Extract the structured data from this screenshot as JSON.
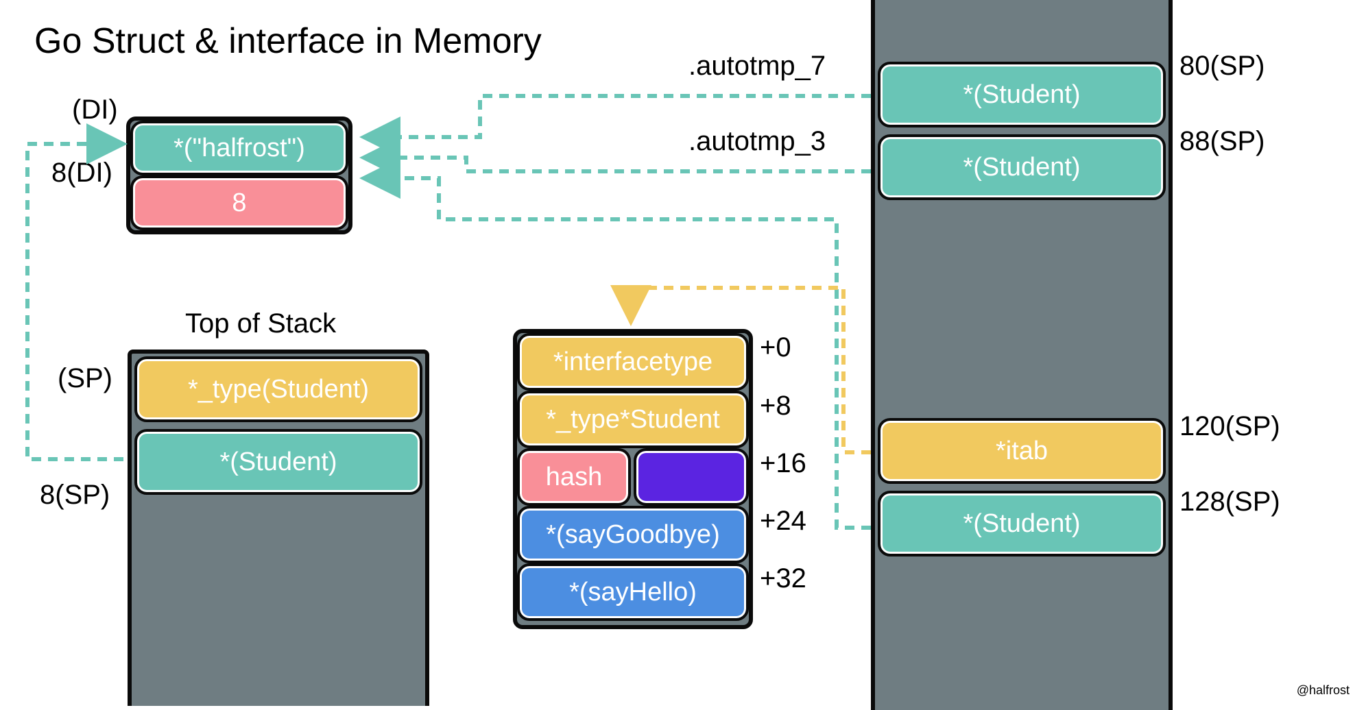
{
  "title": "Go Struct & interface in Memory",
  "watermark": "@halfrost",
  "di_box": {
    "label_top": "(DI)",
    "label_bottom": "8(DI)",
    "row0": "*(\"halfrost\")",
    "row1": "8"
  },
  "stack_left": {
    "title": "Top of Stack",
    "label_sp": "(SP)",
    "label_8sp": "8(SP)",
    "row0": "*_type(Student)",
    "row1": "*(Student)"
  },
  "itab_box": {
    "offsets": {
      "o0": "+0",
      "o8": "+8",
      "o16": "+16",
      "o24": "+24",
      "o32": "+32"
    },
    "row0": "*interfacetype",
    "row1": "*_type*Student",
    "row2a": "hash",
    "row2b": "",
    "row3": "*(sayGoodbye)",
    "row4": "*(sayHello)"
  },
  "right_col": {
    "autotmp7": ".autotmp_7",
    "autotmp3": ".autotmp_3",
    "sp80": "80(SP)",
    "sp88": "88(SP)",
    "sp120": "120(SP)",
    "sp128": "128(SP)",
    "row80": "*(Student)",
    "row88": "*(Student)",
    "row120": "*itab",
    "row128": "*(Student)"
  }
}
